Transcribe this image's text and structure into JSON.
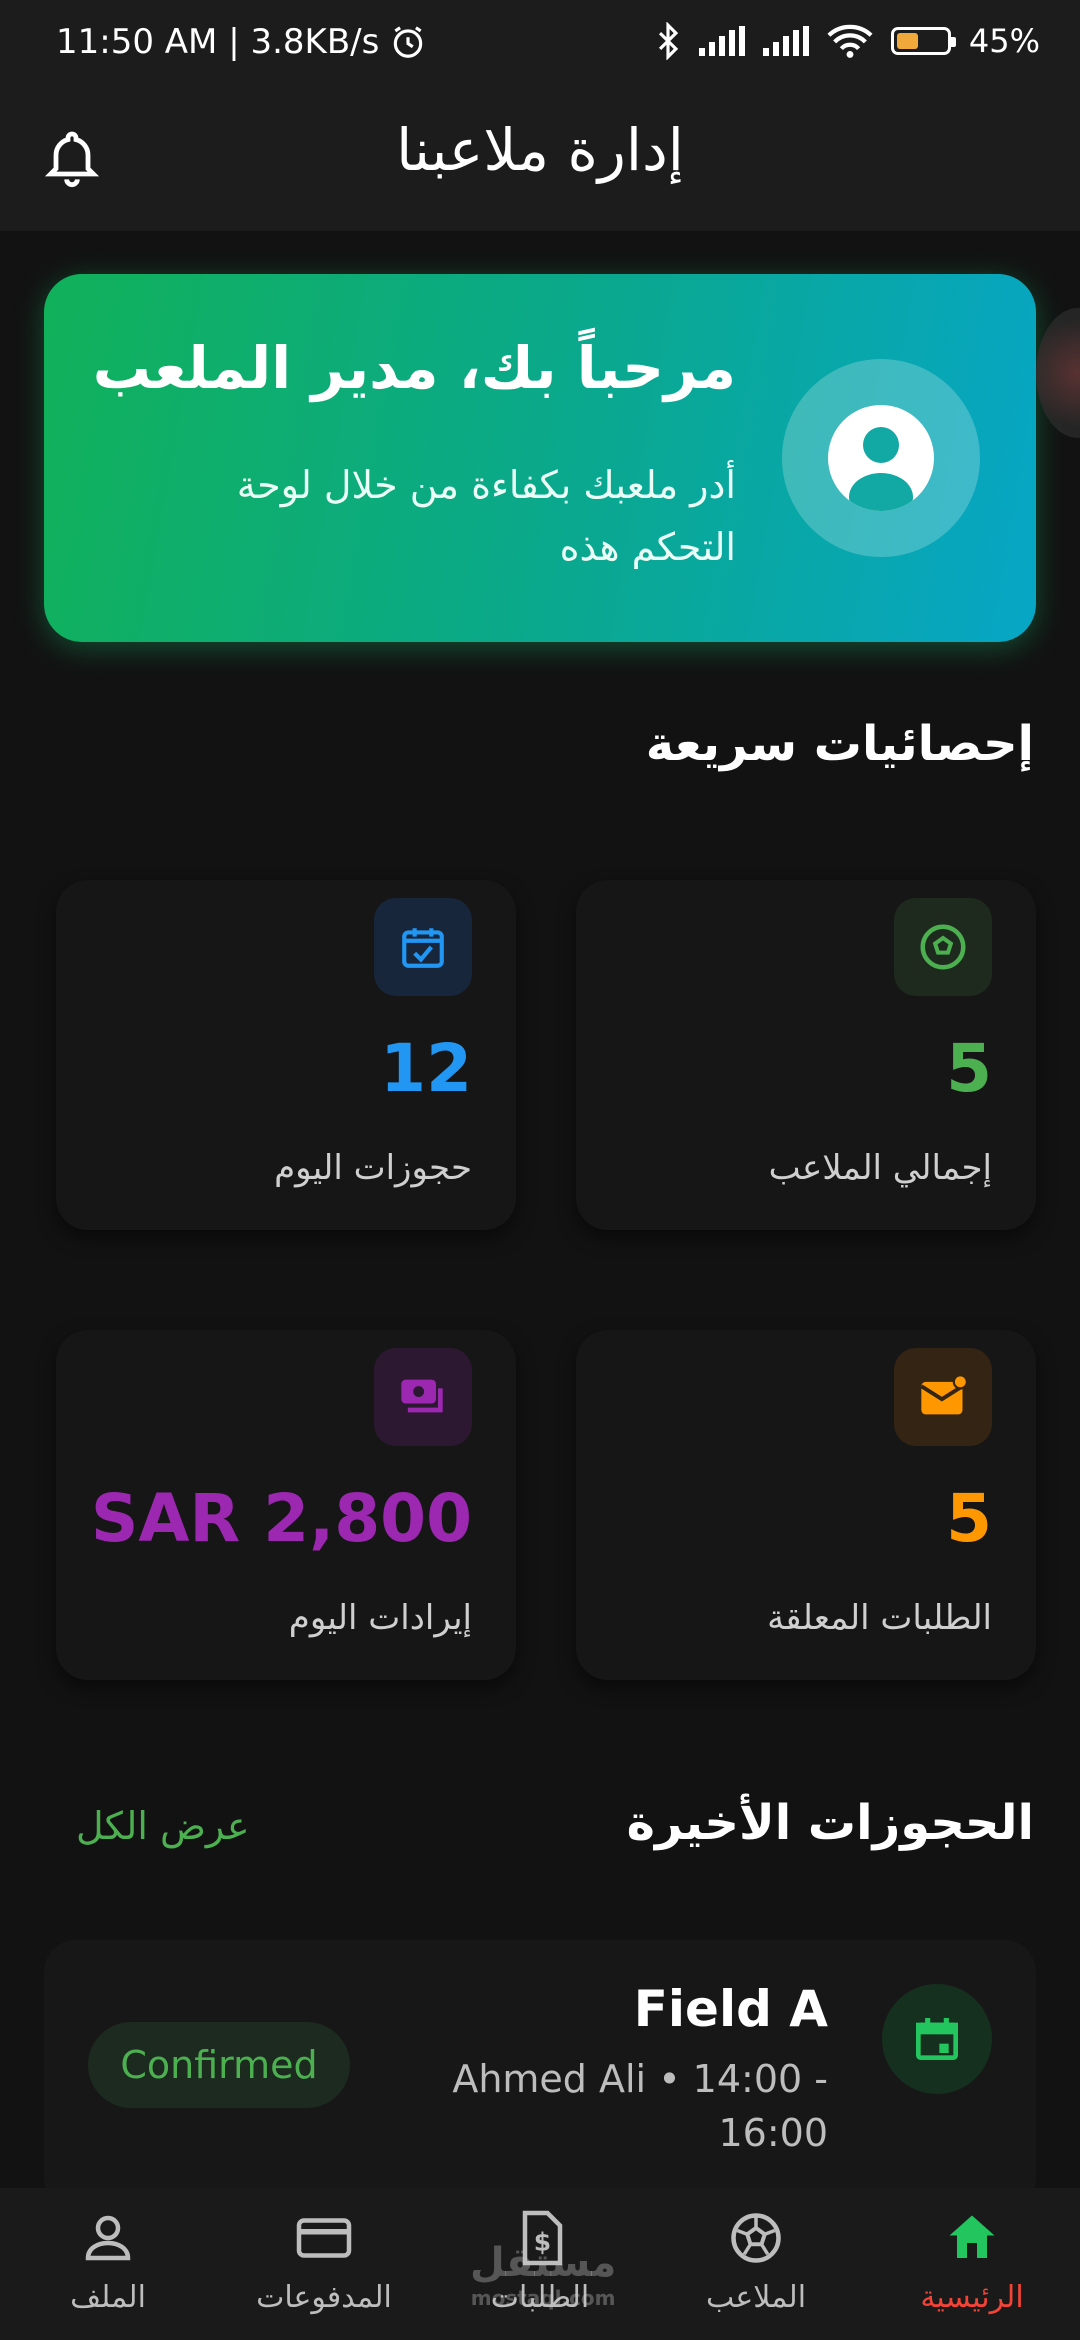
{
  "status_bar": {
    "time_info": "11:50 AM | 3.8KB/s",
    "battery_level": 0.45,
    "battery_text": "45%"
  },
  "app_bar": {
    "title": "إدارة ملاعبنا"
  },
  "welcome": {
    "heading": "مرحباً بك، مدير الملعب",
    "subtitle": "أدر ملعبك بكفاءة من خلال لوحة التحكم هذه"
  },
  "quick_stats": {
    "title": "إحصائيات سريعة",
    "cards": [
      {
        "value": "5",
        "label": "إجمالي الملاعب",
        "icon": "soccer-ball-icon",
        "color": "#4caf50"
      },
      {
        "value": "12",
        "label": "حجوزات اليوم",
        "icon": "calendar-check-icon",
        "color": "#2196f3"
      },
      {
        "value": "5",
        "label": "الطلبات المعلقة",
        "icon": "mail-notification-icon",
        "color": "#ff9800"
      },
      {
        "value": "SAR 2,800",
        "label": "إيرادات اليوم",
        "icon": "payments-icon",
        "color": "#9c27b0"
      }
    ]
  },
  "recent_bookings": {
    "title": "الحجوزات الأخيرة",
    "view_all": "عرض الكل",
    "items": [
      {
        "field": "Field A",
        "details": "Ahmed Ali • 14:00 - 16:00",
        "status": "Confirmed"
      }
    ]
  },
  "bottom_nav": {
    "items": [
      {
        "label": "الرئيسية",
        "icon": "home-icon",
        "active": true
      },
      {
        "label": "الملاعب",
        "icon": "soccer-ball-icon"
      },
      {
        "label": "الطلبات",
        "icon": "document-dollar-icon"
      },
      {
        "label": "المدفوعات",
        "icon": "credit-card-icon"
      },
      {
        "label": "الملف",
        "icon": "person-icon"
      }
    ]
  },
  "watermark": {
    "text": "مستقل",
    "sub": "mostaql.com"
  }
}
